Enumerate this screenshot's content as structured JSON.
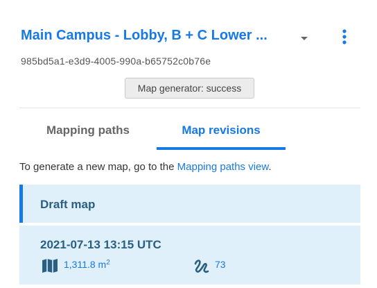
{
  "header": {
    "title": "Main Campus - Lobby, B + C Lower ...",
    "map_id": "985bd5a1-e3d9-4005-990a-b65752c0b76e",
    "status": "Map generator: success"
  },
  "tabs": [
    {
      "label": "Mapping paths",
      "active": false
    },
    {
      "label": "Map revisions",
      "active": true
    }
  ],
  "info": {
    "text_before": "To generate a new map, go to the ",
    "link": "Mapping paths view",
    "text_after": "."
  },
  "draft": {
    "label": "Draft map"
  },
  "revision": {
    "date": "2021-07-13 13:15 UTC",
    "area_value": "1,311.8 m",
    "area_unit_exponent": "2",
    "path_count": "73"
  },
  "icons": {
    "dropdown": "chevron-down-icon",
    "menu": "kebab-menu-icon",
    "area": "map-icon",
    "paths": "path-icon"
  },
  "colors": {
    "accent": "#1779e3",
    "card_background": "#dff0fa",
    "card_text": "#2a5f82"
  }
}
